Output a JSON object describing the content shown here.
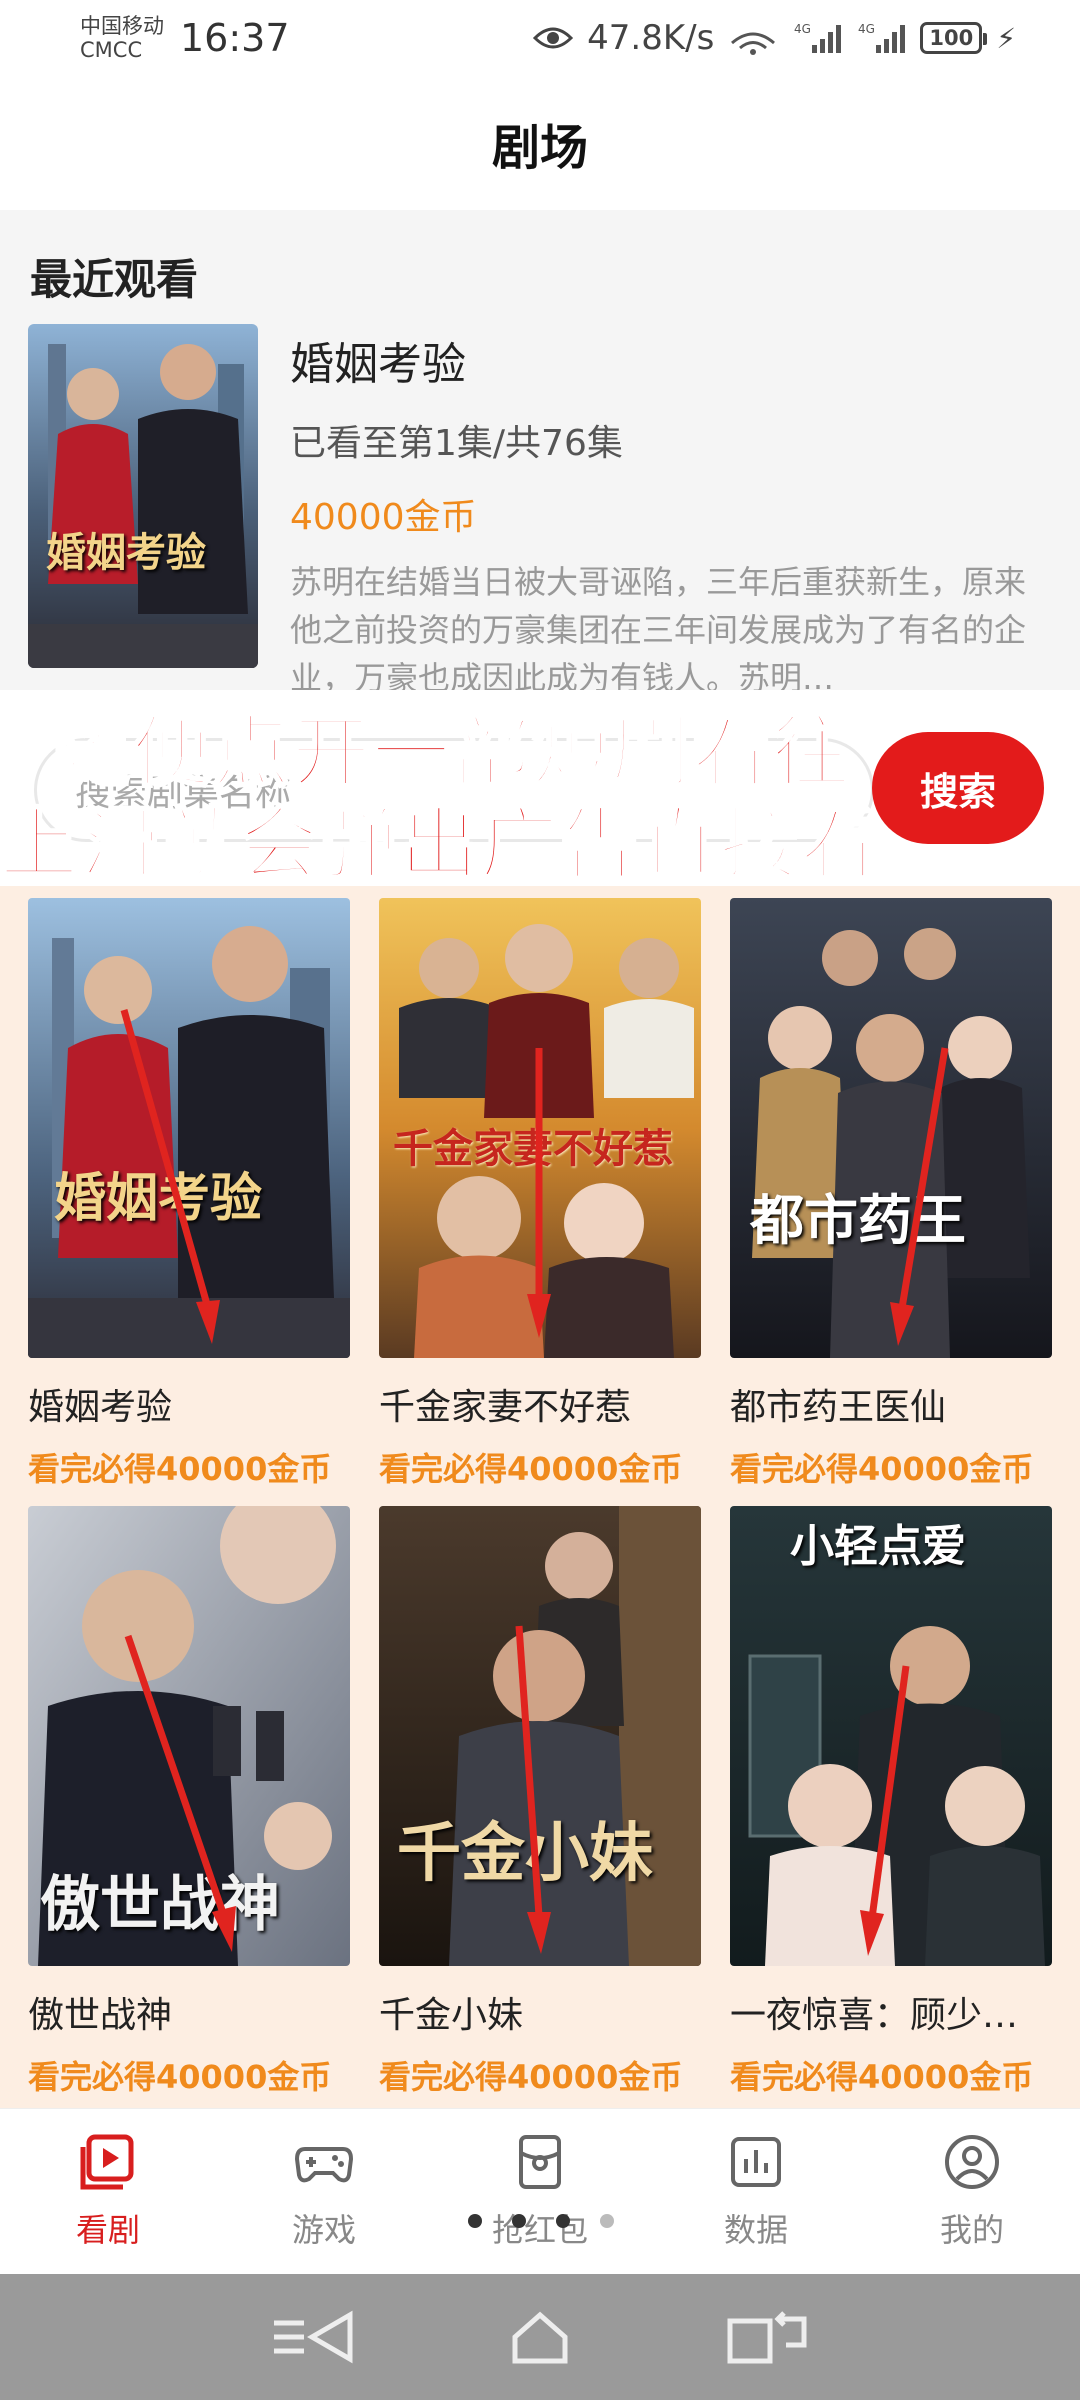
{
  "status_bar": {
    "carrier_line1": "中国移动",
    "carrier_line2": "CMCC",
    "time": "16:37",
    "net_speed": "47.8K/s",
    "network_1": "4G",
    "network_2": "4G",
    "battery": "100"
  },
  "header": {
    "title": "剧场"
  },
  "recent": {
    "heading": "最近观看",
    "title": "婚姻考验",
    "progress": "已看至第1集/共76集",
    "coins": "40000金币",
    "description": "苏明在结婚当日被大哥诬陷，三年后重获新生，原来他之前投资的万豪集团在三年间发展成为了有名的企业，万豪也成因此成为有钱人。苏明…",
    "poster_text": "婚姻考验"
  },
  "search": {
    "placeholder": "搜索剧集名称",
    "button_label": "搜索"
  },
  "overlay_caption": {
    "line1": "随便点开一部短剧看往",
    "line2": "上滑就会弹出广告直接看"
  },
  "dramas": [
    {
      "title": "婚姻考验",
      "reward": "看完必得40000金币",
      "poster_text": "婚姻考验"
    },
    {
      "title": "千金家妻不好惹",
      "reward": "看完必得40000金币",
      "poster_text": "千金家妻不好惹"
    },
    {
      "title": "都市药王医仙",
      "reward": "看完必得40000金币",
      "poster_text": "都市药王"
    },
    {
      "title": "傲世战神",
      "reward": "看完必得40000金币",
      "poster_text": "傲世战神"
    },
    {
      "title": "千金小妹",
      "reward": "看完必得40000金币",
      "poster_text": "千金小妹"
    },
    {
      "title": "一夜惊喜：顾少…",
      "reward": "看完必得40000金币",
      "poster_text": "小轻点爱"
    }
  ],
  "bottom_nav": [
    {
      "label": "看剧",
      "icon": "play-video-icon",
      "active": true
    },
    {
      "label": "游戏",
      "icon": "gamepad-icon",
      "active": false
    },
    {
      "label": "抢红包",
      "icon": "red-packet-icon",
      "active": false
    },
    {
      "label": "数据",
      "icon": "bar-chart-icon",
      "active": false
    },
    {
      "label": "我的",
      "icon": "profile-icon",
      "active": false
    }
  ],
  "colors": {
    "accent_red": "#e31b1b",
    "coin_orange": "#f08a1c",
    "grid_background": "#fdeee2"
  }
}
